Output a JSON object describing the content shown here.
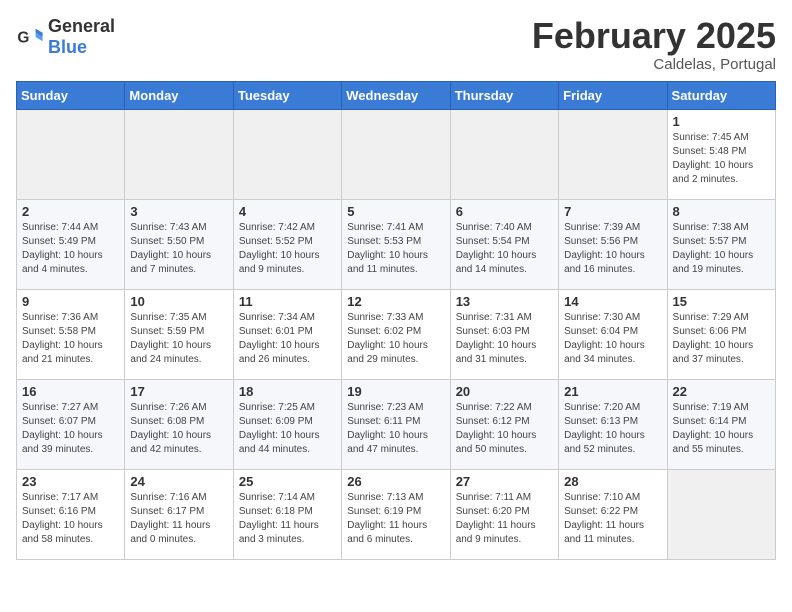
{
  "logo": {
    "general": "General",
    "blue": "Blue"
  },
  "title": "February 2025",
  "subtitle": "Caldelas, Portugal",
  "days_of_week": [
    "Sunday",
    "Monday",
    "Tuesday",
    "Wednesday",
    "Thursday",
    "Friday",
    "Saturday"
  ],
  "weeks": [
    [
      {
        "day": "",
        "info": ""
      },
      {
        "day": "",
        "info": ""
      },
      {
        "day": "",
        "info": ""
      },
      {
        "day": "",
        "info": ""
      },
      {
        "day": "",
        "info": ""
      },
      {
        "day": "",
        "info": ""
      },
      {
        "day": "1",
        "info": "Sunrise: 7:45 AM\nSunset: 5:48 PM\nDaylight: 10 hours and 2 minutes."
      }
    ],
    [
      {
        "day": "2",
        "info": "Sunrise: 7:44 AM\nSunset: 5:49 PM\nDaylight: 10 hours and 4 minutes."
      },
      {
        "day": "3",
        "info": "Sunrise: 7:43 AM\nSunset: 5:50 PM\nDaylight: 10 hours and 7 minutes."
      },
      {
        "day": "4",
        "info": "Sunrise: 7:42 AM\nSunset: 5:52 PM\nDaylight: 10 hours and 9 minutes."
      },
      {
        "day": "5",
        "info": "Sunrise: 7:41 AM\nSunset: 5:53 PM\nDaylight: 10 hours and 11 minutes."
      },
      {
        "day": "6",
        "info": "Sunrise: 7:40 AM\nSunset: 5:54 PM\nDaylight: 10 hours and 14 minutes."
      },
      {
        "day": "7",
        "info": "Sunrise: 7:39 AM\nSunset: 5:56 PM\nDaylight: 10 hours and 16 minutes."
      },
      {
        "day": "8",
        "info": "Sunrise: 7:38 AM\nSunset: 5:57 PM\nDaylight: 10 hours and 19 minutes."
      }
    ],
    [
      {
        "day": "9",
        "info": "Sunrise: 7:36 AM\nSunset: 5:58 PM\nDaylight: 10 hours and 21 minutes."
      },
      {
        "day": "10",
        "info": "Sunrise: 7:35 AM\nSunset: 5:59 PM\nDaylight: 10 hours and 24 minutes."
      },
      {
        "day": "11",
        "info": "Sunrise: 7:34 AM\nSunset: 6:01 PM\nDaylight: 10 hours and 26 minutes."
      },
      {
        "day": "12",
        "info": "Sunrise: 7:33 AM\nSunset: 6:02 PM\nDaylight: 10 hours and 29 minutes."
      },
      {
        "day": "13",
        "info": "Sunrise: 7:31 AM\nSunset: 6:03 PM\nDaylight: 10 hours and 31 minutes."
      },
      {
        "day": "14",
        "info": "Sunrise: 7:30 AM\nSunset: 6:04 PM\nDaylight: 10 hours and 34 minutes."
      },
      {
        "day": "15",
        "info": "Sunrise: 7:29 AM\nSunset: 6:06 PM\nDaylight: 10 hours and 37 minutes."
      }
    ],
    [
      {
        "day": "16",
        "info": "Sunrise: 7:27 AM\nSunset: 6:07 PM\nDaylight: 10 hours and 39 minutes."
      },
      {
        "day": "17",
        "info": "Sunrise: 7:26 AM\nSunset: 6:08 PM\nDaylight: 10 hours and 42 minutes."
      },
      {
        "day": "18",
        "info": "Sunrise: 7:25 AM\nSunset: 6:09 PM\nDaylight: 10 hours and 44 minutes."
      },
      {
        "day": "19",
        "info": "Sunrise: 7:23 AM\nSunset: 6:11 PM\nDaylight: 10 hours and 47 minutes."
      },
      {
        "day": "20",
        "info": "Sunrise: 7:22 AM\nSunset: 6:12 PM\nDaylight: 10 hours and 50 minutes."
      },
      {
        "day": "21",
        "info": "Sunrise: 7:20 AM\nSunset: 6:13 PM\nDaylight: 10 hours and 52 minutes."
      },
      {
        "day": "22",
        "info": "Sunrise: 7:19 AM\nSunset: 6:14 PM\nDaylight: 10 hours and 55 minutes."
      }
    ],
    [
      {
        "day": "23",
        "info": "Sunrise: 7:17 AM\nSunset: 6:16 PM\nDaylight: 10 hours and 58 minutes."
      },
      {
        "day": "24",
        "info": "Sunrise: 7:16 AM\nSunset: 6:17 PM\nDaylight: 11 hours and 0 minutes."
      },
      {
        "day": "25",
        "info": "Sunrise: 7:14 AM\nSunset: 6:18 PM\nDaylight: 11 hours and 3 minutes."
      },
      {
        "day": "26",
        "info": "Sunrise: 7:13 AM\nSunset: 6:19 PM\nDaylight: 11 hours and 6 minutes."
      },
      {
        "day": "27",
        "info": "Sunrise: 7:11 AM\nSunset: 6:20 PM\nDaylight: 11 hours and 9 minutes."
      },
      {
        "day": "28",
        "info": "Sunrise: 7:10 AM\nSunset: 6:22 PM\nDaylight: 11 hours and 11 minutes."
      },
      {
        "day": "",
        "info": ""
      }
    ]
  ]
}
